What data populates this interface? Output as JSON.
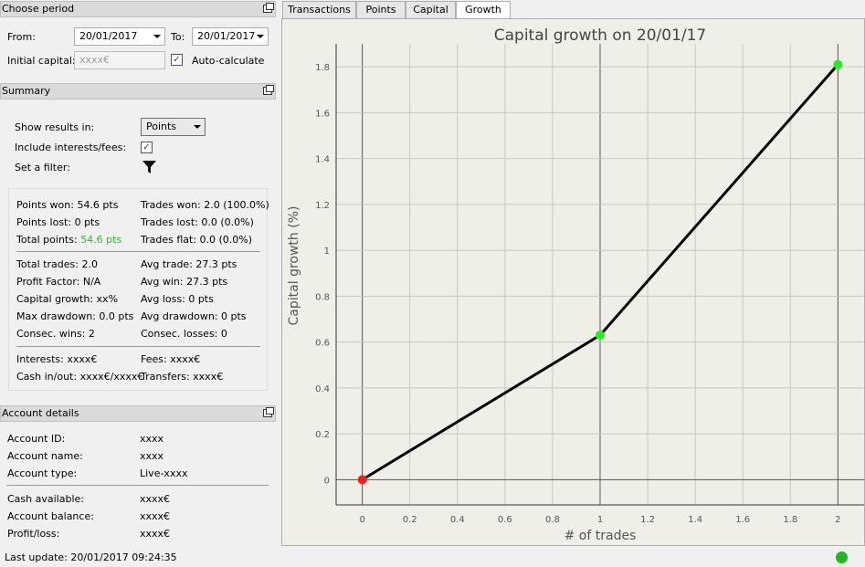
{
  "period": {
    "title": "Choose period",
    "from_label": "From:",
    "from_value": "20/01/2017",
    "to_label": "To:",
    "to_value": "20/01/2017",
    "initial_capital_label": "Initial capital:",
    "initial_capital_placeholder": "xxxx€",
    "auto_calc_label": "Auto-calculate",
    "auto_calc_checked": true
  },
  "summary": {
    "title": "Summary",
    "show_results_label": "Show results in:",
    "show_results_value": "Points",
    "include_interests_label": "Include interests/fees:",
    "include_interests_checked": true,
    "filter_label": "Set a filter:",
    "stats": {
      "points_won": "Points won: 54.6 pts",
      "trades_won": "Trades won: 2.0 (100.0%)",
      "points_lost": "Points lost: 0 pts",
      "trades_lost": "Trades lost: 0.0 (0.0%)",
      "total_points_label": "Total points:",
      "total_points_value": "54.6 pts",
      "trades_flat": "Trades flat: 0.0 (0.0%)",
      "total_trades": "Total trades: 2.0",
      "avg_trade": "Avg trade: 27.3 pts",
      "profit_factor": "Profit Factor: N/A",
      "avg_win": "Avg win: 27.3 pts",
      "capital_growth": "Capital growth: xx%",
      "avg_loss": "Avg loss: 0 pts",
      "max_drawdown": "Max drawdown: 0.0 pts",
      "avg_drawdown": "Avg drawdown: 0 pts",
      "consec_wins": "Consec. wins: 2",
      "consec_losses": "Consec. losses: 0",
      "interests": "Interests: xxxx€",
      "fees": "Fees: xxxx€",
      "cash_inout": "Cash in/out: xxxx€/xxxx€",
      "transfers": "Transfers: xxxx€"
    }
  },
  "account": {
    "title": "Account details",
    "id_label": "Account ID:",
    "id_value": "xxxx",
    "name_label": "Account name:",
    "name_value": "xxxx",
    "type_label": "Account type:",
    "type_value": "Live-xxxx",
    "cash_label": "Cash available:",
    "cash_value": "xxxx€",
    "balance_label": "Account balance:",
    "balance_value": "xxxx€",
    "pl_label": "Profit/loss:",
    "pl_value": "xxxx€"
  },
  "status": {
    "last_update": "Last update: 20/01/2017 09:24:35",
    "indicator_color": "#1fb81f"
  },
  "tabs": [
    "Transactions",
    "Points",
    "Capital",
    "Growth"
  ],
  "active_tab": "Growth",
  "chart_data": {
    "type": "line",
    "title": "Capital growth on 20/01/17",
    "xlabel": "# of trades",
    "ylabel": "Capital growth (%)",
    "x": [
      0,
      1,
      2
    ],
    "y": [
      0,
      0.63,
      1.81
    ],
    "point_colors": [
      "#ff1a1a",
      "#22ee22",
      "#22ee22"
    ],
    "line_color": "#000000",
    "xlim": [
      -0.11,
      2.11
    ],
    "ylim": [
      -0.11,
      1.9
    ],
    "xticks": [
      "0",
      "0.2",
      "0.4",
      "0.6",
      "0.8",
      "1",
      "1.2",
      "1.4",
      "1.6",
      "1.8",
      "2"
    ],
    "yticks": [
      "0",
      "0.2",
      "0.4",
      "0.6",
      "0.8",
      "1",
      "1.2",
      "1.4",
      "1.6",
      "1.8"
    ],
    "grid": true
  }
}
